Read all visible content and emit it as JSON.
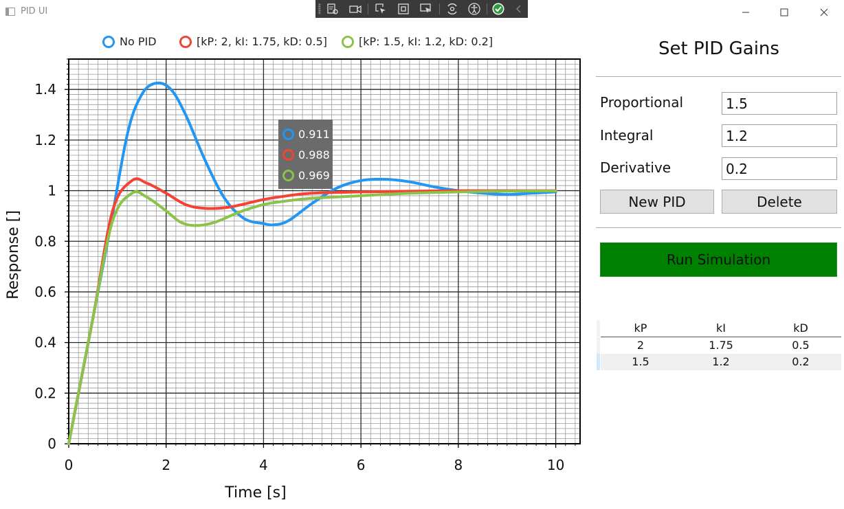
{
  "window": {
    "title": "PID UI",
    "controls": {
      "minimize": "—",
      "maximize": "☐",
      "close": "✕"
    }
  },
  "devtools_toolbar": {
    "icons": [
      "live-visual-tree-icon",
      "record-icon",
      "select-element-icon",
      "display-layout-adorners-icon",
      "track-focus-icon",
      "hot-reload-icon",
      "accessibility-icon",
      "binding-check-icon",
      "collapse-icon"
    ]
  },
  "legend": [
    {
      "label": "No PID",
      "color": "#2196F3"
    },
    {
      "label": "[kP: 2, kI: 1.75, kD: 0.5]",
      "color": "#F44336"
    },
    {
      "label": "[kP: 1.5, kI: 1.2, kD: 0.2]",
      "color": "#8BC34A"
    }
  ],
  "chart_data": {
    "type": "line",
    "xlabel": "Time [s]",
    "ylabel": "Response []",
    "xlim": [
      0,
      10.5
    ],
    "ylim": [
      0,
      1.52
    ],
    "xticks": [
      0,
      2,
      4,
      6,
      8,
      10
    ],
    "xtick_labels": [
      "0",
      "2",
      "4",
      "6",
      "8",
      "10"
    ],
    "yticks": [
      0,
      0.2,
      0.4,
      0.6,
      0.8,
      1,
      1.2,
      1.4
    ],
    "ytick_labels": [
      "0",
      "0.2",
      "0.4",
      "0.6",
      "0.8",
      "1",
      "1.2",
      "1.4"
    ],
    "grid": true,
    "series": [
      {
        "name": "No PID",
        "color": "#2196F3",
        "x": [
          0,
          0.8,
          1.2,
          1.5,
          1.8,
          2.1,
          2.4,
          2.8,
          3.2,
          3.6,
          4.0,
          4.2,
          4.5,
          5.0,
          5.5,
          6.0,
          6.5,
          7.0,
          7.5,
          8.0,
          8.5,
          9.0,
          9.5,
          10.0
        ],
        "y": [
          0,
          0.8,
          1.22,
          1.38,
          1.425,
          1.4,
          1.3,
          1.12,
          0.97,
          0.89,
          0.87,
          0.865,
          0.88,
          0.95,
          1.01,
          1.04,
          1.045,
          1.035,
          1.015,
          1.0,
          0.99,
          0.985,
          0.99,
          0.995
        ]
      },
      {
        "name": "[kP: 2, kI: 1.75, kD: 0.5]",
        "color": "#F44336",
        "x": [
          0,
          0.5,
          0.9,
          1.3,
          1.6,
          2.0,
          2.4,
          2.8,
          3.3,
          4.0,
          4.5,
          5.0,
          6.0,
          7.0,
          8.0,
          9.0,
          10.0
        ],
        "y": [
          0,
          0.5,
          0.92,
          1.04,
          1.03,
          0.99,
          0.945,
          0.93,
          0.935,
          0.965,
          0.98,
          0.99,
          0.995,
          0.998,
          1.0,
          1.0,
          1.0
        ]
      },
      {
        "name": "[kP: 1.5, kI: 1.2, kD: 0.2]",
        "color": "#8BC34A",
        "x": [
          0,
          0.5,
          0.9,
          1.3,
          1.6,
          2.0,
          2.3,
          2.6,
          3.0,
          3.5,
          4.0,
          4.5,
          5.0,
          6.0,
          7.0,
          8.0,
          9.0,
          10.0
        ],
        "y": [
          0,
          0.5,
          0.88,
          0.99,
          0.975,
          0.92,
          0.875,
          0.862,
          0.875,
          0.915,
          0.945,
          0.96,
          0.97,
          0.98,
          0.99,
          0.995,
          0.998,
          0.999
        ]
      }
    ],
    "tooltip": [
      {
        "value": "0.911",
        "color": "#2196F3"
      },
      {
        "value": "0.988",
        "color": "#F44336"
      },
      {
        "value": "0.969",
        "color": "#8BC34A"
      }
    ]
  },
  "panel": {
    "title": "Set PID Gains",
    "proportional_label": "Proportional",
    "proportional_value": "1.5",
    "integral_label": "Integral",
    "integral_value": "1.2",
    "derivative_label": "Derivative",
    "derivative_value": "0.2",
    "new_button": "New PID",
    "delete_button": "Delete",
    "run_button": "Run Simulation",
    "run_color": "#008000"
  },
  "table": {
    "headers": [
      "kP",
      "kI",
      "kD"
    ],
    "rows": [
      [
        "2",
        "1.75",
        "0.5"
      ],
      [
        "1.5",
        "1.2",
        "0.2"
      ]
    ]
  }
}
